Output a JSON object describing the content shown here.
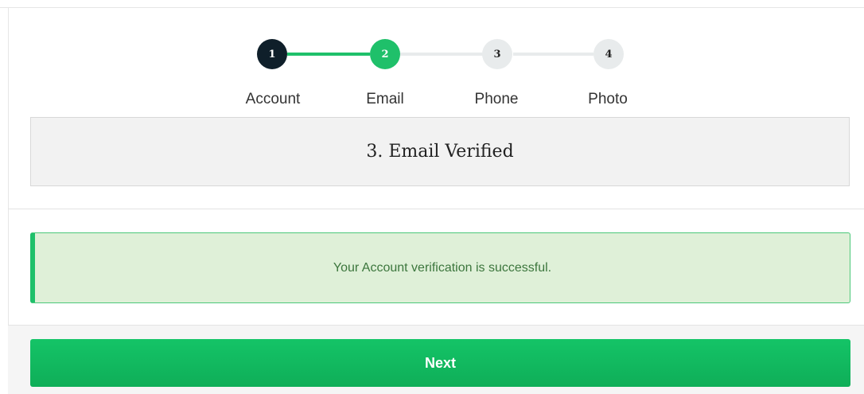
{
  "stepper": {
    "steps": [
      {
        "number": "1",
        "label": "Account",
        "state": "done"
      },
      {
        "number": "2",
        "label": "Email",
        "state": "active"
      },
      {
        "number": "3",
        "label": "Phone",
        "state": "todo"
      },
      {
        "number": "4",
        "label": "Photo",
        "state": "todo"
      }
    ]
  },
  "section": {
    "title": "3. Email Verified"
  },
  "alert": {
    "message": "Your Account verification is successful."
  },
  "footer": {
    "next_label": "Next"
  },
  "colors": {
    "accent_green": "#1fc06a",
    "done_dark": "#0f1f2a",
    "pending_gray": "#e8ebec",
    "alert_bg": "#dff0d8",
    "alert_text": "#3c763d"
  }
}
